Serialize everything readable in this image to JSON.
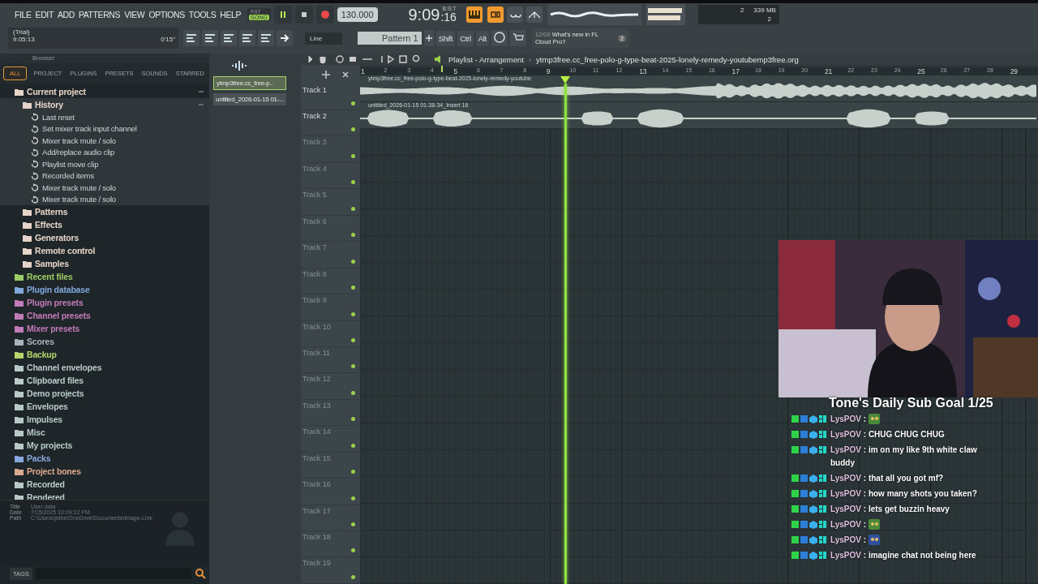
{
  "menu": [
    "FILE",
    "EDIT",
    "ADD",
    "PATTERNS",
    "VIEW",
    "OPTIONS",
    "TOOLS",
    "HELP"
  ],
  "transport": {
    "mode_top": "PAT",
    "mode": "SONG",
    "song_mode": true,
    "tempo": "130.000",
    "time": "9:09",
    "time_small": ":16",
    "time_label": "B:S:T",
    "meter_a": "2",
    "memory": "339 MB",
    "meter_b": "2"
  },
  "hint": {
    "title": "(Trial)",
    "elapsed": "9:05:13",
    "length": "0'15\""
  },
  "toolbar": {
    "snap": "Line",
    "pattern": "Pattern 1",
    "modifiers": [
      "Shift",
      "Ctrl",
      "Alt"
    ],
    "news_date": "12/09",
    "news": "What's new in FL Cloud Pro?",
    "news_count": "2"
  },
  "browser": {
    "title": "Browser",
    "tabs": [
      {
        "label": "ALL",
        "selected": true
      },
      {
        "label": "PROJECT",
        "selected": false
      },
      {
        "label": "PLUGINS",
        "selected": false
      },
      {
        "label": "PRESETS",
        "selected": false
      },
      {
        "label": "SOUNDS",
        "selected": false
      },
      {
        "label": "STARRED",
        "selected": false
      }
    ],
    "tree": [
      {
        "label": "Current project",
        "color": "#e6d4c8",
        "expanded": true,
        "children": [
          {
            "label": "History",
            "color": "#e6d4c8",
            "expanded": true,
            "children": [
              {
                "label": "Last reset"
              },
              {
                "label": "Set mixer track input channel"
              },
              {
                "label": "Mixer track mute / solo"
              },
              {
                "label": "Add/replace audio clip"
              },
              {
                "label": "Playlist move clip"
              },
              {
                "label": "Recorded items"
              },
              {
                "label": "Mixer track mute / solo"
              },
              {
                "label": "Mixer track mute / solo"
              }
            ]
          },
          {
            "label": "Patterns",
            "color": "#e6d4c8"
          },
          {
            "label": "Effects",
            "color": "#e6d4c8"
          },
          {
            "label": "Generators",
            "color": "#e6d4c8"
          },
          {
            "label": "Remote control",
            "color": "#e6d4c8"
          },
          {
            "label": "Samples",
            "color": "#e6d4c8"
          }
        ]
      },
      {
        "label": "Recent files",
        "color": "#9ccc65"
      },
      {
        "label": "Plugin database",
        "color": "#7fa8dc"
      },
      {
        "label": "Plugin presets",
        "color": "#c27ab8"
      },
      {
        "label": "Channel presets",
        "color": "#c27ab8"
      },
      {
        "label": "Mixer presets",
        "color": "#c27ab8"
      },
      {
        "label": "Scores",
        "color": "#a9b4bc"
      },
      {
        "label": "Backup",
        "color": "#b4d46c"
      },
      {
        "label": "Channel envelopes",
        "color": "#b9c9c9"
      },
      {
        "label": "Clipboard files",
        "color": "#b9c9c9"
      },
      {
        "label": "Demo projects",
        "color": "#b9c9c9"
      },
      {
        "label": "Envelopes",
        "color": "#b9c9c9"
      },
      {
        "label": "Impulses",
        "color": "#b9c9c9"
      },
      {
        "label": "Misc",
        "color": "#b9c9c9"
      },
      {
        "label": "My projects",
        "color": "#b9c9c9"
      },
      {
        "label": "Packs",
        "color": "#8aa8e0"
      },
      {
        "label": "Project bones",
        "color": "#dca88e"
      },
      {
        "label": "Recorded",
        "color": "#b9c9c9"
      },
      {
        "label": "Rendered",
        "color": "#b9c9c9"
      }
    ],
    "info": [
      {
        "label": "Title",
        "value": "User data"
      },
      {
        "label": "Date",
        "value": "7/15/2025 10:09:12 PM"
      },
      {
        "label": "Path",
        "value": "C:\\Users\\jnthe\\OneDrive\\Documents\\Image-Line"
      }
    ],
    "tags": "TAGS"
  },
  "clips": [
    {
      "label": "ytmp3free.cc_free-p..",
      "selected": true
    },
    {
      "label": "untitled_2026-01-15 01-...",
      "selected": false
    }
  ],
  "playlist": {
    "title": "Playlist - Arrangement",
    "separator": "›",
    "file": "ytmp3free.cc_free-polo-g-type-beat-2025-lonely-remedy-youtubemp3free.org",
    "ruler": [
      "1",
      "2",
      "3",
      "4",
      "5",
      "6",
      "7",
      "8",
      "9",
      "10",
      "11",
      "12",
      "13",
      "14",
      "15",
      "16",
      "17",
      "18",
      "19",
      "20",
      "21",
      "22",
      "23",
      "24",
      "25",
      "26",
      "27",
      "28",
      "29"
    ],
    "tracks": [
      {
        "name": "Track 1",
        "clip": "ytmp3free.cc_free-polo-g-type-beat-2025-lonely-remedy-youtube"
      },
      {
        "name": "Track 2",
        "clip": "untitled_2026-01-15 01-38-34_Insert 16"
      },
      {
        "name": "Track 3"
      },
      {
        "name": "Track 4"
      },
      {
        "name": "Track 5"
      },
      {
        "name": "Track 6"
      },
      {
        "name": "Track 7"
      },
      {
        "name": "Track 8"
      },
      {
        "name": "Track 9"
      },
      {
        "name": "Track 10"
      },
      {
        "name": "Track 11"
      },
      {
        "name": "Track 12"
      },
      {
        "name": "Track 13"
      },
      {
        "name": "Track 14"
      },
      {
        "name": "Track 15"
      },
      {
        "name": "Track 16"
      },
      {
        "name": "Track 17"
      },
      {
        "name": "Track 18"
      },
      {
        "name": "Track 19"
      }
    ]
  },
  "overlay": {
    "goal": "Tone's Daily Sub Goal 1/25",
    "chat": [
      {
        "user": "LysPOV",
        "separator": ":",
        "kind": "emote"
      },
      {
        "user": "LysPOV",
        "separator": ":",
        "kind": "text",
        "text": "CHUG CHUG CHUG"
      },
      {
        "user": "LysPOV",
        "separator": ":",
        "kind": "text",
        "text": "im on my like 9th white claw buddy"
      },
      {
        "user": "LysPOV",
        "separator": ":",
        "kind": "text",
        "text": "that all you got mf?"
      },
      {
        "user": "LysPOV",
        "separator": ":",
        "kind": "text",
        "text": "how many shots you taken?"
      },
      {
        "user": "LysPOV",
        "separator": ":",
        "kind": "text",
        "text": "lets get buzzin heavy"
      },
      {
        "user": "LysPOV",
        "separator": ":",
        "kind": "emote"
      },
      {
        "user": "LysPOV",
        "separator": ":",
        "kind": "emote"
      },
      {
        "user": "LysPOV",
        "separator": ":",
        "kind": "text",
        "text": "imagine chat not being here"
      }
    ]
  }
}
